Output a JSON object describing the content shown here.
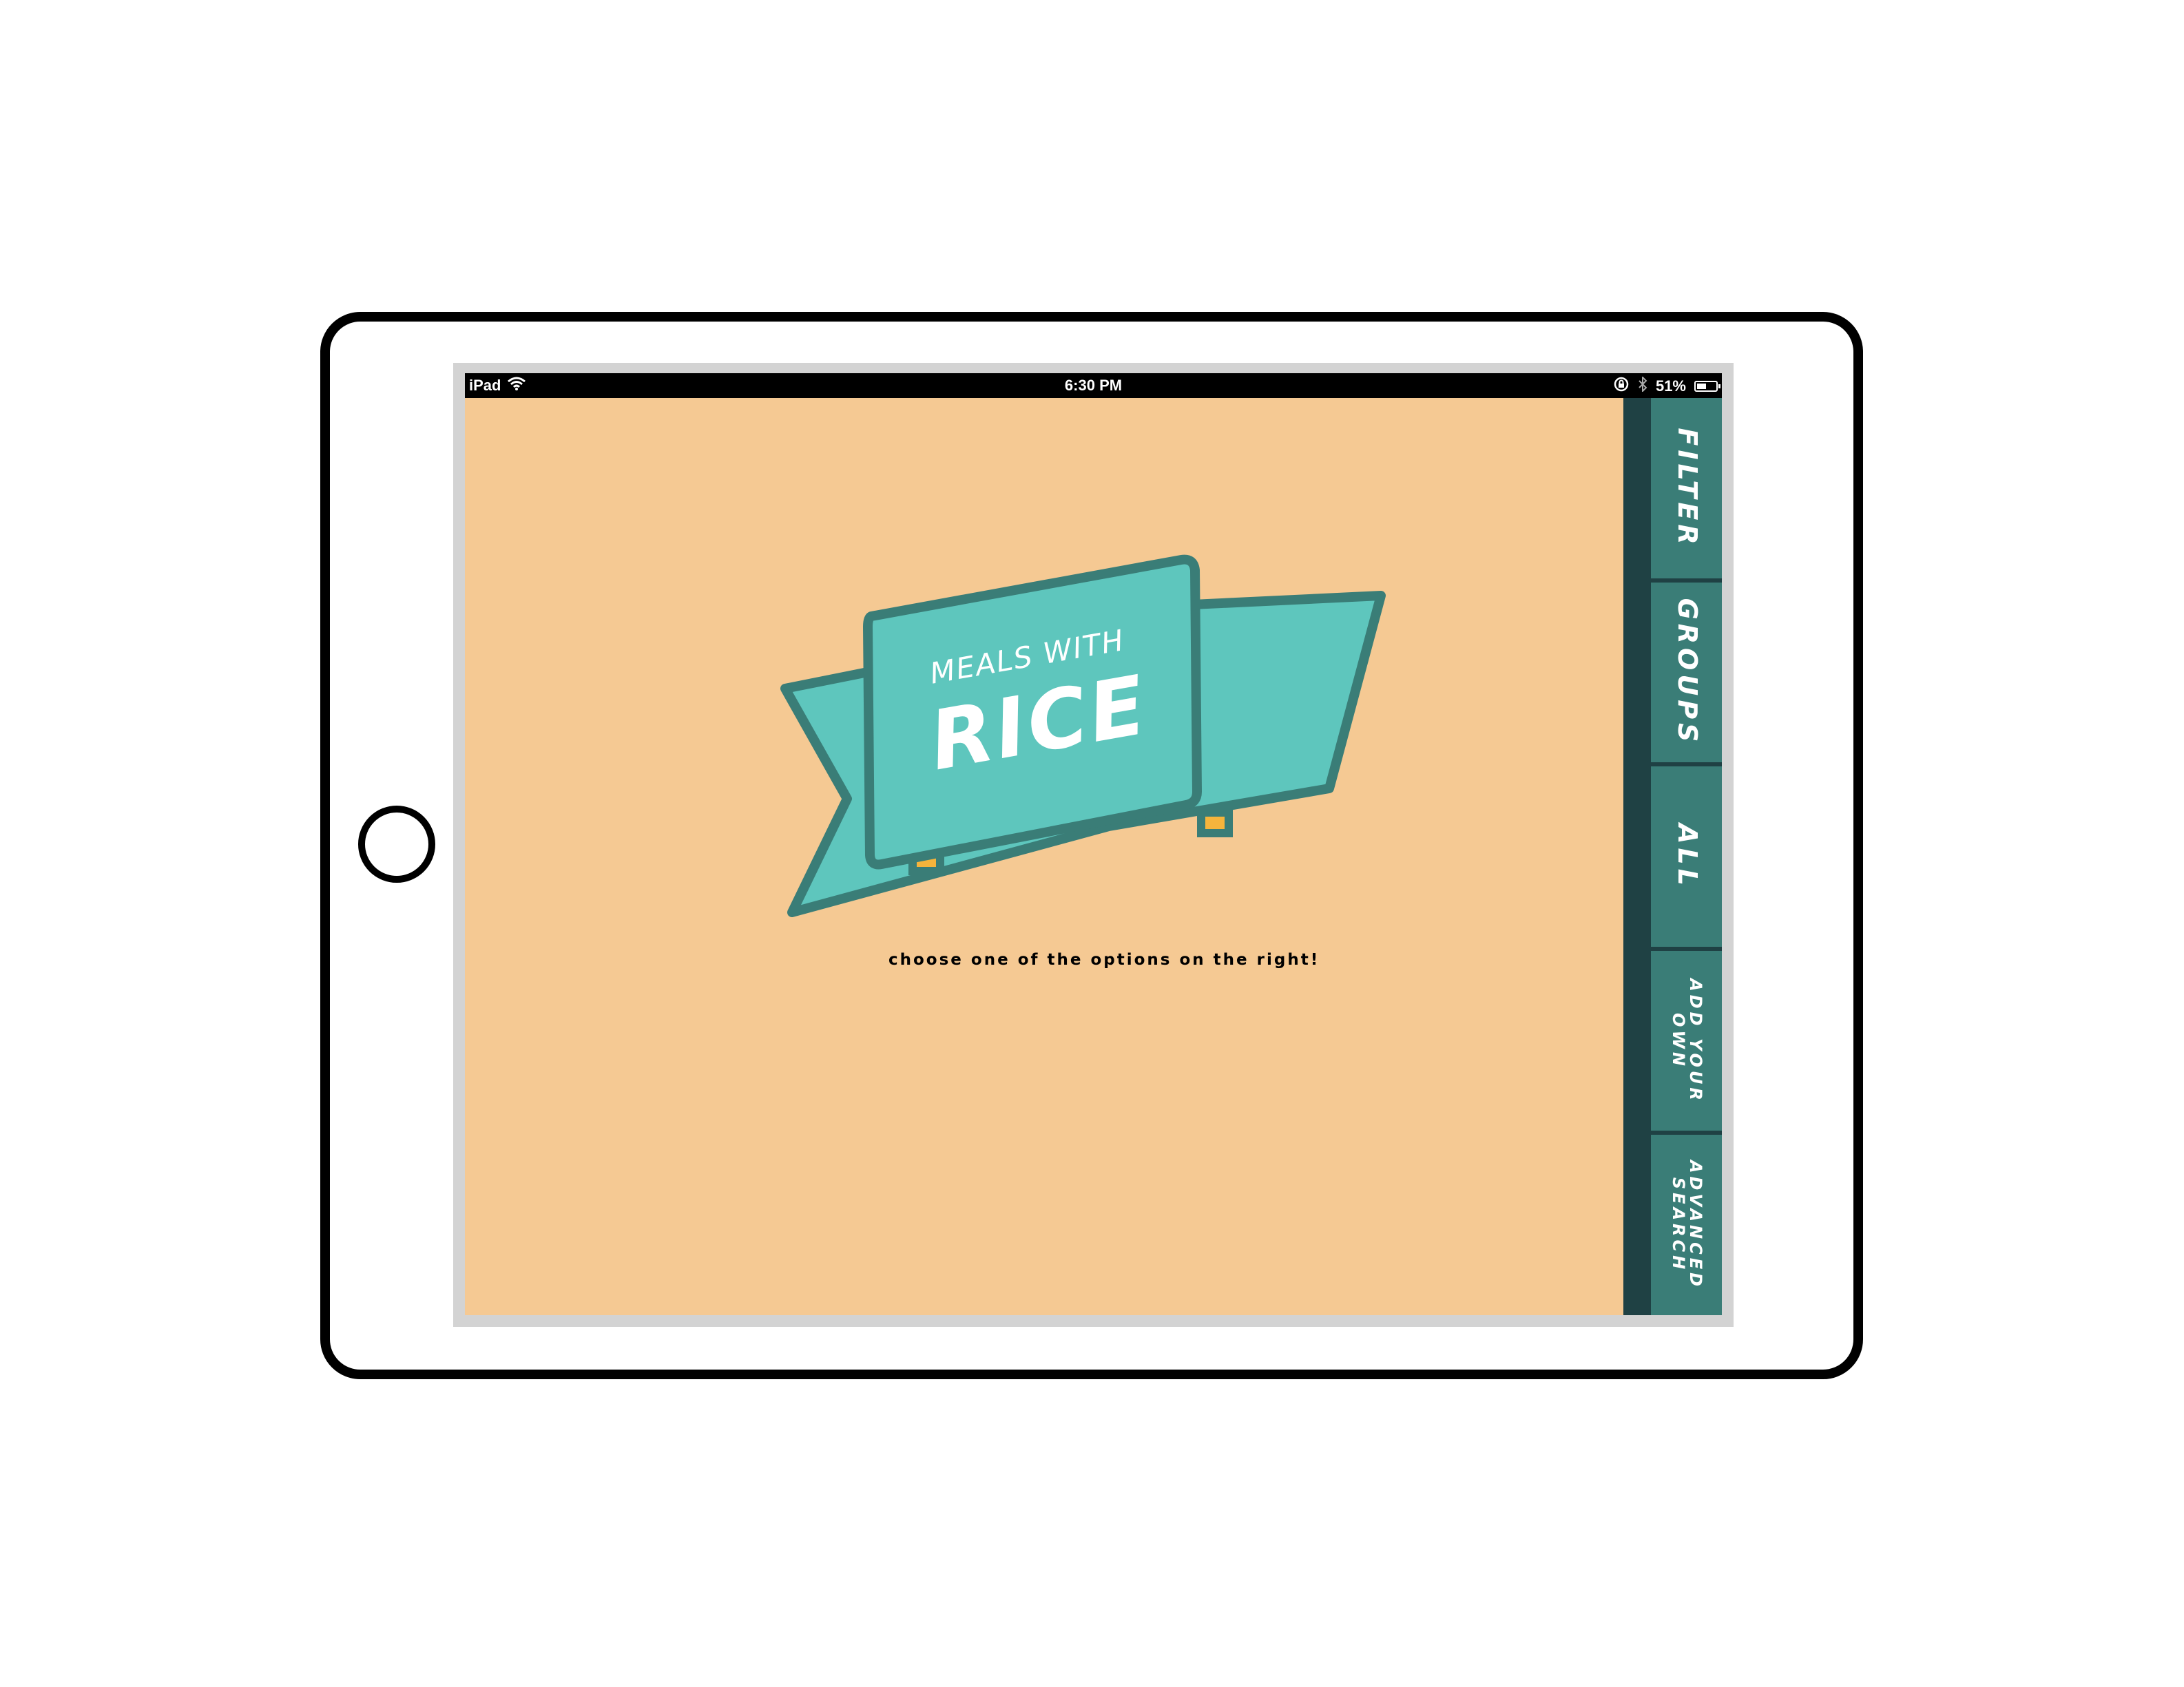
{
  "status_bar": {
    "device": "iPad",
    "time": "6:30 PM",
    "battery": "51%",
    "battery_level": 0.51
  },
  "banner": {
    "line1": "MEALS WITH",
    "line2": "RICE"
  },
  "tagline": "choose one of the options on the right!",
  "nav": {
    "filter": "FILTER",
    "groups": "GROUPS",
    "all": "ALL",
    "add_your_own": "ADD YOUR\nOWN",
    "advanced_search": "ADVANCED\nSEARCH"
  },
  "colors": {
    "background": "#f5c993",
    "ribbon_fill": "#5ec6bd",
    "ribbon_outline": "#3a7d77",
    "nav_fill": "#3a7d77",
    "nav_dark": "#1f4144",
    "ribbon_accent": "#f5b43c"
  }
}
